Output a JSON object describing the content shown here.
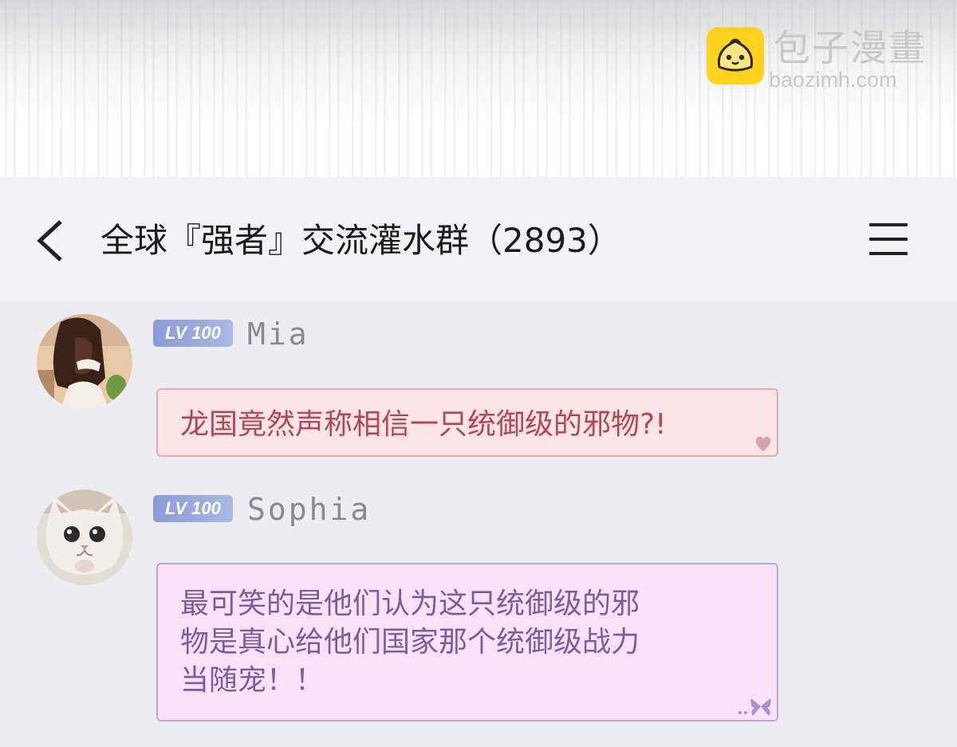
{
  "watermark": {
    "brand_name": "包子漫畫",
    "brand_url": "baozimh.com",
    "logo_icon": "bun-face-icon"
  },
  "header": {
    "back_icon": "chevron-left-icon",
    "title": "全球『强者』交流灌水群（2893）",
    "menu_icon": "hamburger-menu-icon"
  },
  "messages": [
    {
      "level": "LV 100",
      "username": "Mia",
      "text": "龙国竟然声称相信一只统御级的邪物?!",
      "bubble_decoration": "heart-icon",
      "colors": {
        "bubble_bg": "#fde4e6",
        "bubble_border": "#e9a6ad",
        "text": "#b5484f"
      }
    },
    {
      "level": "LV 100",
      "username": "Sophia",
      "text_lines": [
        "最可笑的是他们认为这只统御级的邪",
        "物是真心给他们国家那个统御级战力",
        "当随宠！！"
      ],
      "bubble_decoration": "butterfly-icon",
      "colors": {
        "bubble_bg": "#fce1f8",
        "bubble_border": "#bba7e0",
        "text": "#7f5aa6"
      }
    }
  ],
  "colors": {
    "logo": "#ffd21f",
    "level_badge": "#8a9bd6",
    "header_bg": "#f3f3f7",
    "chat_bg": "#ececf1"
  }
}
